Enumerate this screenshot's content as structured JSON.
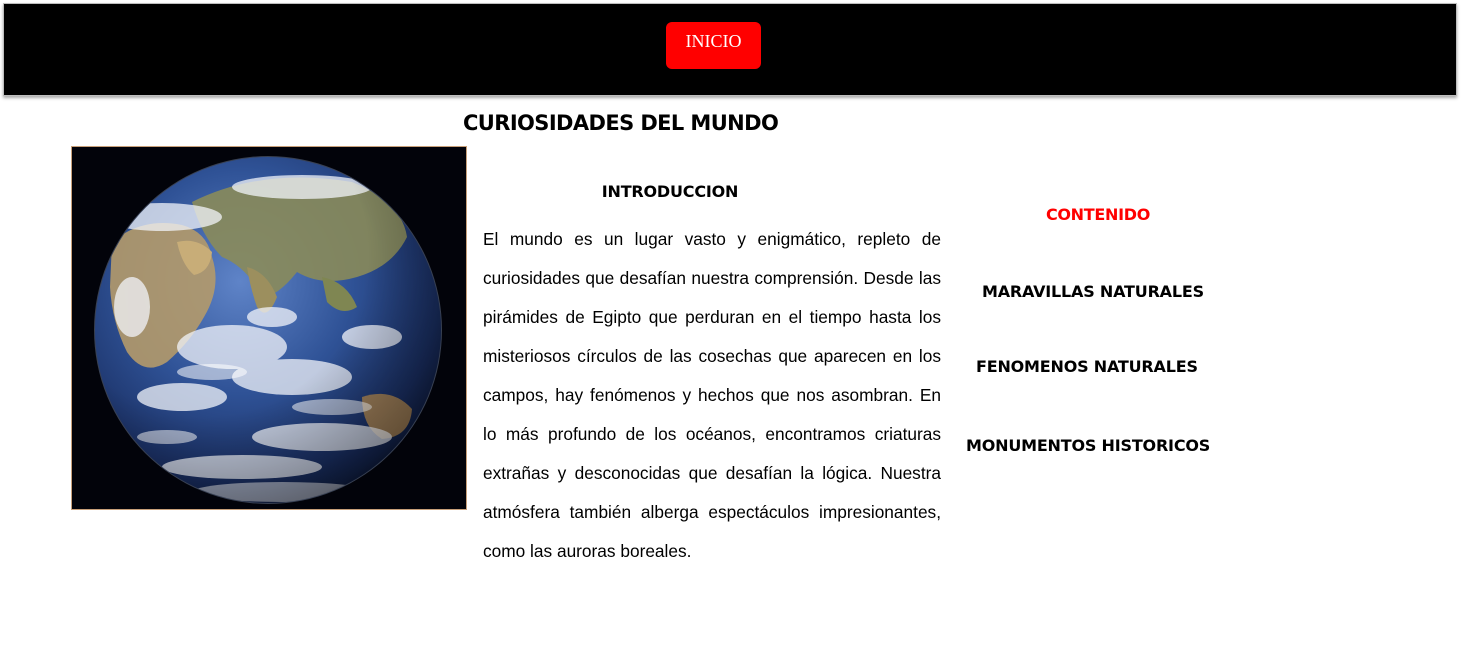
{
  "nav": {
    "inicio_label": "INICIO",
    "button_color": "#ff0000",
    "bar_color": "#000000"
  },
  "page": {
    "title": "CURIOSIDADES DEL MUNDO"
  },
  "image": {
    "subject": "earth-globe"
  },
  "intro": {
    "heading": "INTRODUCCION",
    "text": "El mundo es un lugar vasto y enigmático, repleto de curiosidades que desafían nuestra comprensión. Desde las pirámides de Egipto que perduran en el tiempo hasta los misteriosos círculos de las cosechas que aparecen en los campos, hay fenómenos y hechos que nos asombran. En lo más profundo de los océanos, encontramos criaturas extrañas y desconocidas que desafían la lógica. Nuestra atmósfera también alberga espectáculos impresionantes, como las auroras boreales."
  },
  "contents": {
    "heading": "CONTENIDO",
    "heading_color": "#ff0000",
    "items": [
      {
        "label": "MARAVILLAS NATURALES"
      },
      {
        "label": "FENOMENOS NATURALES"
      },
      {
        "label": "MONUMENTOS HISTORICOS"
      }
    ]
  }
}
